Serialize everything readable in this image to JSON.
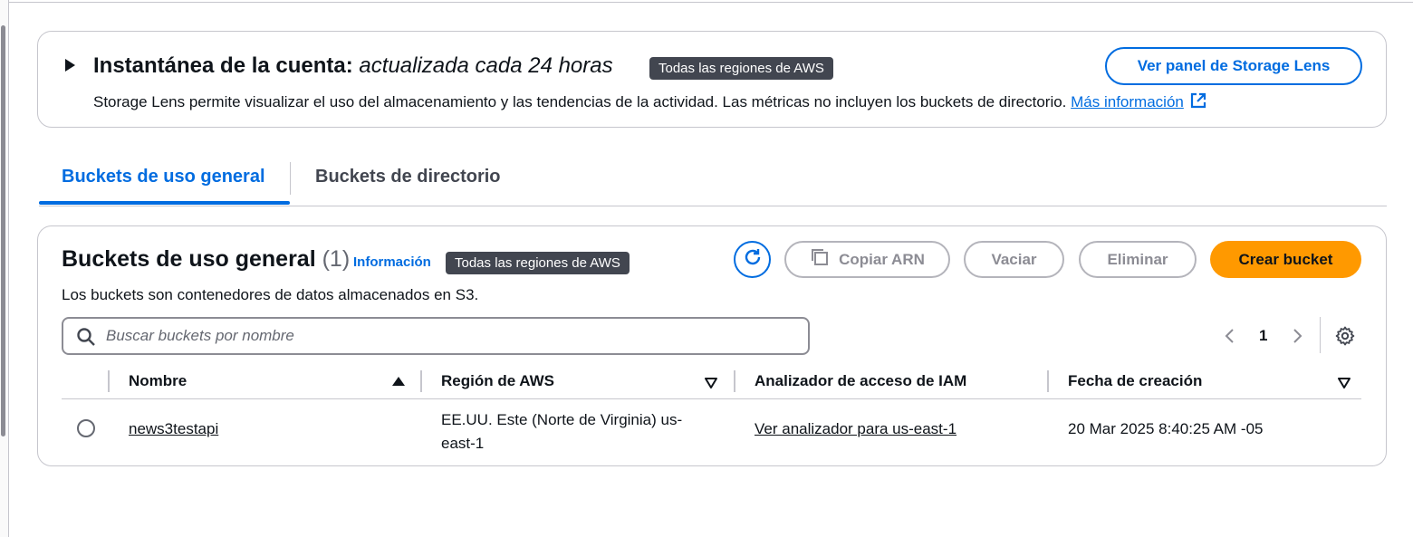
{
  "snapshot": {
    "title": "Instantánea de la cuenta:",
    "subtitle": "actualizada cada 24 horas",
    "regions_badge": "Todas las regiones de AWS",
    "description": "Storage Lens permite visualizar el uso del almacenamiento y las tendencias de la actividad. Las métricas no incluyen los buckets de directorio.",
    "more_info_link": "Más información",
    "dashboard_button": "Ver panel de Storage Lens"
  },
  "tabs": [
    {
      "label": "Buckets de uso general",
      "active": true
    },
    {
      "label": "Buckets de directorio",
      "active": false
    }
  ],
  "panel": {
    "title": "Buckets de uso general",
    "count": "(1)",
    "info_link": "Información",
    "regions_badge": "Todas las regiones de AWS",
    "description": "Los buckets son contenedores de datos almacenados en S3.",
    "copy_arn_button": "Copiar ARN",
    "empty_button": "Vaciar",
    "delete_button": "Eliminar",
    "create_button": "Crear bucket",
    "search_placeholder": "Buscar buckets por nombre",
    "current_page": "1"
  },
  "table": {
    "columns": [
      "Nombre",
      "Región de AWS",
      "Analizador de acceso de IAM",
      "Fecha de creación"
    ],
    "rows": [
      {
        "name": "news3testapi",
        "region": "EE.UU. Este (Norte de Virginia) us-east-1",
        "iam_analyzer": "Ver analizador para us-east-1",
        "created": "20 Mar 2025 8:40:25 AM -05"
      }
    ]
  },
  "colors": {
    "link_blue": "#006ce0",
    "primary_orange": "#ff9900",
    "badge_dark": "#424650",
    "border_gray": "#c6c6cd"
  }
}
